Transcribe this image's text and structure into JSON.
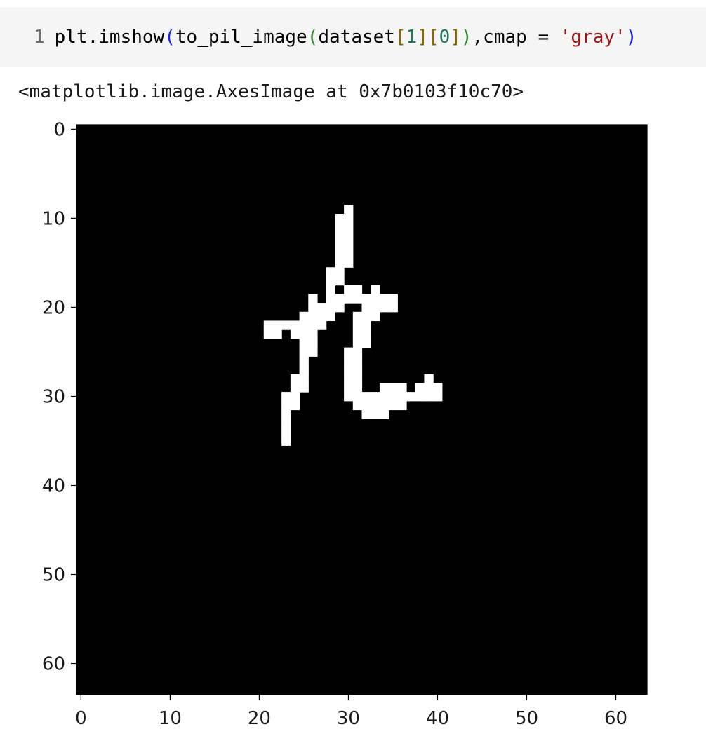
{
  "cell": {
    "line_number": "1",
    "code_tokens": {
      "plt": "plt.imshow",
      "p1": "(",
      "func": "to_pil_image",
      "p2": "(",
      "ds": "dataset",
      "b1o": "[",
      "n1": "1",
      "b1c": "]",
      "b2o": "[",
      "n2": "0",
      "b2c": "]",
      "p2c": ")",
      "cm": ",cmap = ",
      "str": "'gray'",
      "p1c": ")"
    }
  },
  "output": {
    "text": "<matplotlib.image.AxesImage at 0x7b0103f10c70>"
  },
  "chart_data": {
    "type": "heatmap",
    "colormap": "gray",
    "width": 64,
    "height": 64,
    "xlim": [
      0,
      64
    ],
    "ylim": [
      64,
      0
    ],
    "x_ticks": [
      "0",
      "10",
      "20",
      "30",
      "40",
      "50",
      "60"
    ],
    "y_ticks": [
      "0",
      "10",
      "20",
      "30",
      "40",
      "50",
      "60"
    ],
    "pixel_on_color": "#ffffff",
    "pixel_off_color": "#000000",
    "white_pixels": [
      [
        9,
        30
      ],
      [
        10,
        29
      ],
      [
        10,
        30
      ],
      [
        11,
        29
      ],
      [
        11,
        30
      ],
      [
        12,
        29
      ],
      [
        12,
        30
      ],
      [
        13,
        29
      ],
      [
        13,
        30
      ],
      [
        14,
        29
      ],
      [
        14,
        30
      ],
      [
        15,
        29
      ],
      [
        15,
        30
      ],
      [
        16,
        28
      ],
      [
        16,
        29
      ],
      [
        17,
        28
      ],
      [
        17,
        29
      ],
      [
        18,
        28
      ],
      [
        18,
        30
      ],
      [
        18,
        31
      ],
      [
        18,
        33
      ],
      [
        19,
        26
      ],
      [
        19,
        28
      ],
      [
        19,
        29
      ],
      [
        19,
        30
      ],
      [
        19,
        31
      ],
      [
        19,
        32
      ],
      [
        19,
        33
      ],
      [
        19,
        34
      ],
      [
        19,
        35
      ],
      [
        20,
        26
      ],
      [
        20,
        27
      ],
      [
        20,
        28
      ],
      [
        20,
        29
      ],
      [
        20,
        32
      ],
      [
        20,
        33
      ],
      [
        20,
        34
      ],
      [
        20,
        35
      ],
      [
        21,
        25
      ],
      [
        21,
        26
      ],
      [
        21,
        27
      ],
      [
        21,
        28
      ],
      [
        21,
        31
      ],
      [
        21,
        32
      ],
      [
        21,
        33
      ],
      [
        22,
        21
      ],
      [
        22,
        22
      ],
      [
        22,
        23
      ],
      [
        22,
        24
      ],
      [
        22,
        25
      ],
      [
        22,
        26
      ],
      [
        22,
        27
      ],
      [
        22,
        31
      ],
      [
        22,
        32
      ],
      [
        23,
        21
      ],
      [
        23,
        22
      ],
      [
        23,
        24
      ],
      [
        23,
        25
      ],
      [
        23,
        26
      ],
      [
        23,
        31
      ],
      [
        23,
        32
      ],
      [
        24,
        25
      ],
      [
        24,
        26
      ],
      [
        24,
        31
      ],
      [
        24,
        32
      ],
      [
        25,
        25
      ],
      [
        25,
        26
      ],
      [
        25,
        30
      ],
      [
        25,
        31
      ],
      [
        26,
        25
      ],
      [
        26,
        30
      ],
      [
        26,
        31
      ],
      [
        27,
        25
      ],
      [
        27,
        30
      ],
      [
        27,
        31
      ],
      [
        28,
        24
      ],
      [
        28,
        25
      ],
      [
        28,
        30
      ],
      [
        28,
        31
      ],
      [
        28,
        39
      ],
      [
        29,
        24
      ],
      [
        29,
        25
      ],
      [
        29,
        30
      ],
      [
        29,
        31
      ],
      [
        29,
        34
      ],
      [
        29,
        35
      ],
      [
        29,
        36
      ],
      [
        29,
        38
      ],
      [
        29,
        39
      ],
      [
        29,
        40
      ],
      [
        30,
        23
      ],
      [
        30,
        24
      ],
      [
        30,
        30
      ],
      [
        30,
        31
      ],
      [
        30,
        32
      ],
      [
        30,
        33
      ],
      [
        30,
        34
      ],
      [
        30,
        35
      ],
      [
        30,
        36
      ],
      [
        30,
        37
      ],
      [
        30,
        38
      ],
      [
        30,
        39
      ],
      [
        30,
        40
      ],
      [
        31,
        23
      ],
      [
        31,
        24
      ],
      [
        31,
        31
      ],
      [
        31,
        32
      ],
      [
        31,
        33
      ],
      [
        31,
        34
      ],
      [
        31,
        35
      ],
      [
        31,
        36
      ],
      [
        32,
        23
      ],
      [
        32,
        32
      ],
      [
        32,
        33
      ],
      [
        32,
        34
      ],
      [
        33,
        23
      ],
      [
        34,
        23
      ],
      [
        35,
        23
      ]
    ]
  }
}
